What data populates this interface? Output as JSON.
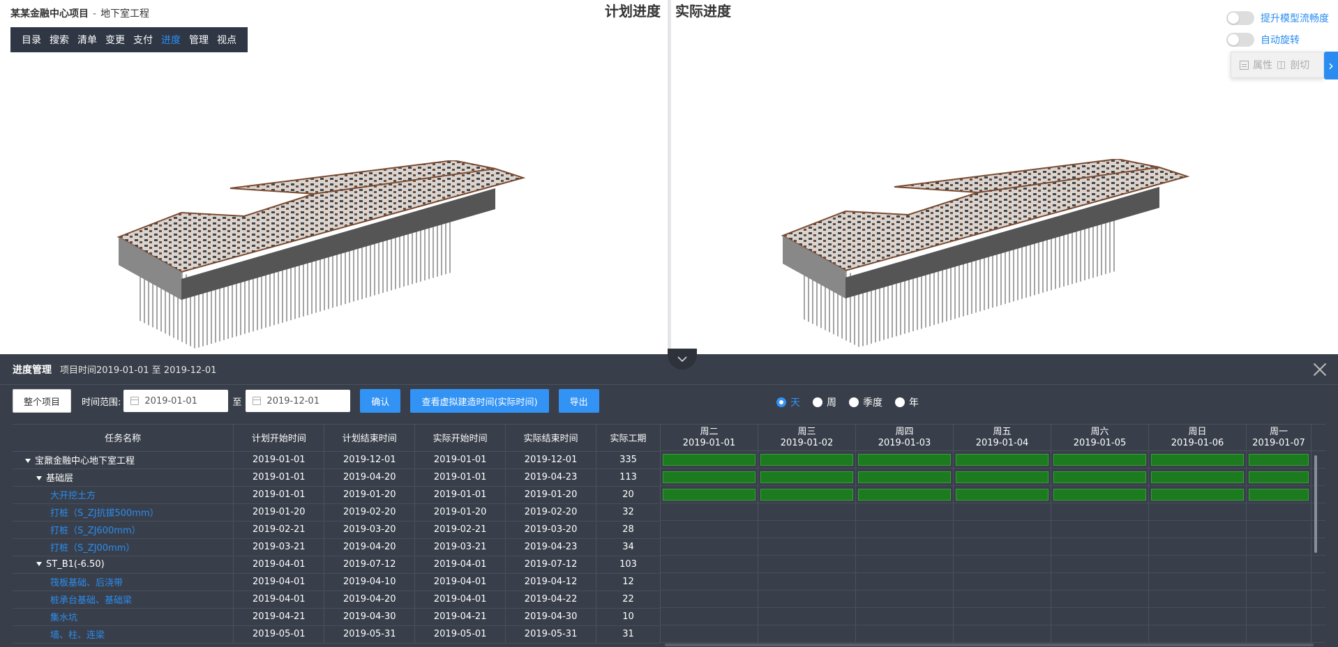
{
  "project": {
    "title": "某某金融中心项目",
    "separator": "-",
    "subtitle": "地下室工程"
  },
  "toolbar": [
    {
      "label": "目录"
    },
    {
      "label": "搜索"
    },
    {
      "label": "清单"
    },
    {
      "label": "变更"
    },
    {
      "label": "支付"
    },
    {
      "label": "进度",
      "active": true
    },
    {
      "label": "管理"
    },
    {
      "label": "视点"
    }
  ],
  "views": {
    "plan_title": "计划进度",
    "actual_title": "实际进度"
  },
  "toggles": [
    {
      "label": "提升模型流畅度",
      "on": false
    },
    {
      "label": "自动旋转",
      "on": false
    }
  ],
  "propbox": {
    "attr_label": "属性",
    "cut_label": "剖切"
  },
  "panel": {
    "title": "进度管理",
    "range": "项目时间2019-01-01 至 2019-12-01",
    "whole_btn": "整个项目",
    "range_label": "时间范围:",
    "start_date": "2019-01-01",
    "to": "至",
    "end_date": "2019-12-01",
    "confirm_btn": "确认",
    "virtual_btn": "查看虚拟建造时间(实际时间)",
    "export_btn": "导出",
    "scales": [
      {
        "label": "天",
        "selected": true
      },
      {
        "label": "周",
        "selected": false
      },
      {
        "label": "季度",
        "selected": false
      },
      {
        "label": "年",
        "selected": false
      }
    ]
  },
  "table": {
    "headers": [
      "任务名称",
      "计划开始时间",
      "计划结束时间",
      "实际开始时间",
      "实际结束时间",
      "实际工期"
    ],
    "rows": [
      {
        "name": "宝鼐金融中心地下室工程",
        "level": 0,
        "expand": true,
        "ps": "2019-01-01",
        "pe": "2019-12-01",
        "as": "2019-01-01",
        "ae": "2019-12-01",
        "dur": "335",
        "bar": true
      },
      {
        "name": "基础层",
        "level": 1,
        "expand": true,
        "ps": "2019-01-01",
        "pe": "2019-04-20",
        "as": "2019-01-01",
        "ae": "2019-04-23",
        "dur": "113",
        "bar": true
      },
      {
        "name": "大开挖土方",
        "level": 2,
        "ps": "2019-01-01",
        "pe": "2019-01-20",
        "as": "2019-01-01",
        "ae": "2019-01-20",
        "dur": "20",
        "bar": true
      },
      {
        "name": "打桩（S_ZJ抗拔500mm）",
        "level": 2,
        "ps": "2019-01-20",
        "pe": "2019-02-20",
        "as": "2019-01-20",
        "ae": "2019-02-20",
        "dur": "32",
        "bar": false
      },
      {
        "name": "打桩（S_ZJ600mm）",
        "level": 2,
        "ps": "2019-02-21",
        "pe": "2019-03-20",
        "as": "2019-02-21",
        "ae": "2019-03-20",
        "dur": "28",
        "bar": false
      },
      {
        "name": "打桩（S_ZJ00mm）",
        "level": 2,
        "ps": "2019-03-21",
        "pe": "2019-04-20",
        "as": "2019-03-21",
        "ae": "2019-04-23",
        "dur": "34",
        "bar": false
      },
      {
        "name": "ST_B1(-6.50)",
        "level": 1,
        "expand": true,
        "ps": "2019-04-01",
        "pe": "2019-07-12",
        "as": "2019-04-01",
        "ae": "2019-07-12",
        "dur": "103",
        "bar": false
      },
      {
        "name": "筏板基础、后浇带",
        "level": 2,
        "ps": "2019-04-01",
        "pe": "2019-04-10",
        "as": "2019-04-01",
        "ae": "2019-04-12",
        "dur": "12",
        "bar": false
      },
      {
        "name": "桩承台基础、基础梁",
        "level": 2,
        "ps": "2019-04-01",
        "pe": "2019-04-20",
        "as": "2019-04-01",
        "ae": "2019-04-22",
        "dur": "22",
        "bar": false
      },
      {
        "name": "集水坑",
        "level": 2,
        "ps": "2019-04-21",
        "pe": "2019-04-30",
        "as": "2019-04-21",
        "ae": "2019-04-30",
        "dur": "10",
        "bar": false
      },
      {
        "name": "墙、柱、连梁",
        "level": 2,
        "ps": "2019-05-01",
        "pe": "2019-05-31",
        "as": "2019-05-01",
        "ae": "2019-05-31",
        "dur": "31",
        "bar": false
      }
    ]
  },
  "gantt": {
    "days": [
      {
        "wd": "周二",
        "date": "2019-01-01"
      },
      {
        "wd": "周三",
        "date": "2019-01-02"
      },
      {
        "wd": "周四",
        "date": "2019-01-03"
      },
      {
        "wd": "周五",
        "date": "2019-01-04"
      },
      {
        "wd": "周六",
        "date": "2019-01-05"
      },
      {
        "wd": "周日",
        "date": "2019-01-06"
      },
      {
        "wd": "周一",
        "date": "2019-01-07"
      }
    ],
    "bar_color": "#1c7a1f"
  }
}
